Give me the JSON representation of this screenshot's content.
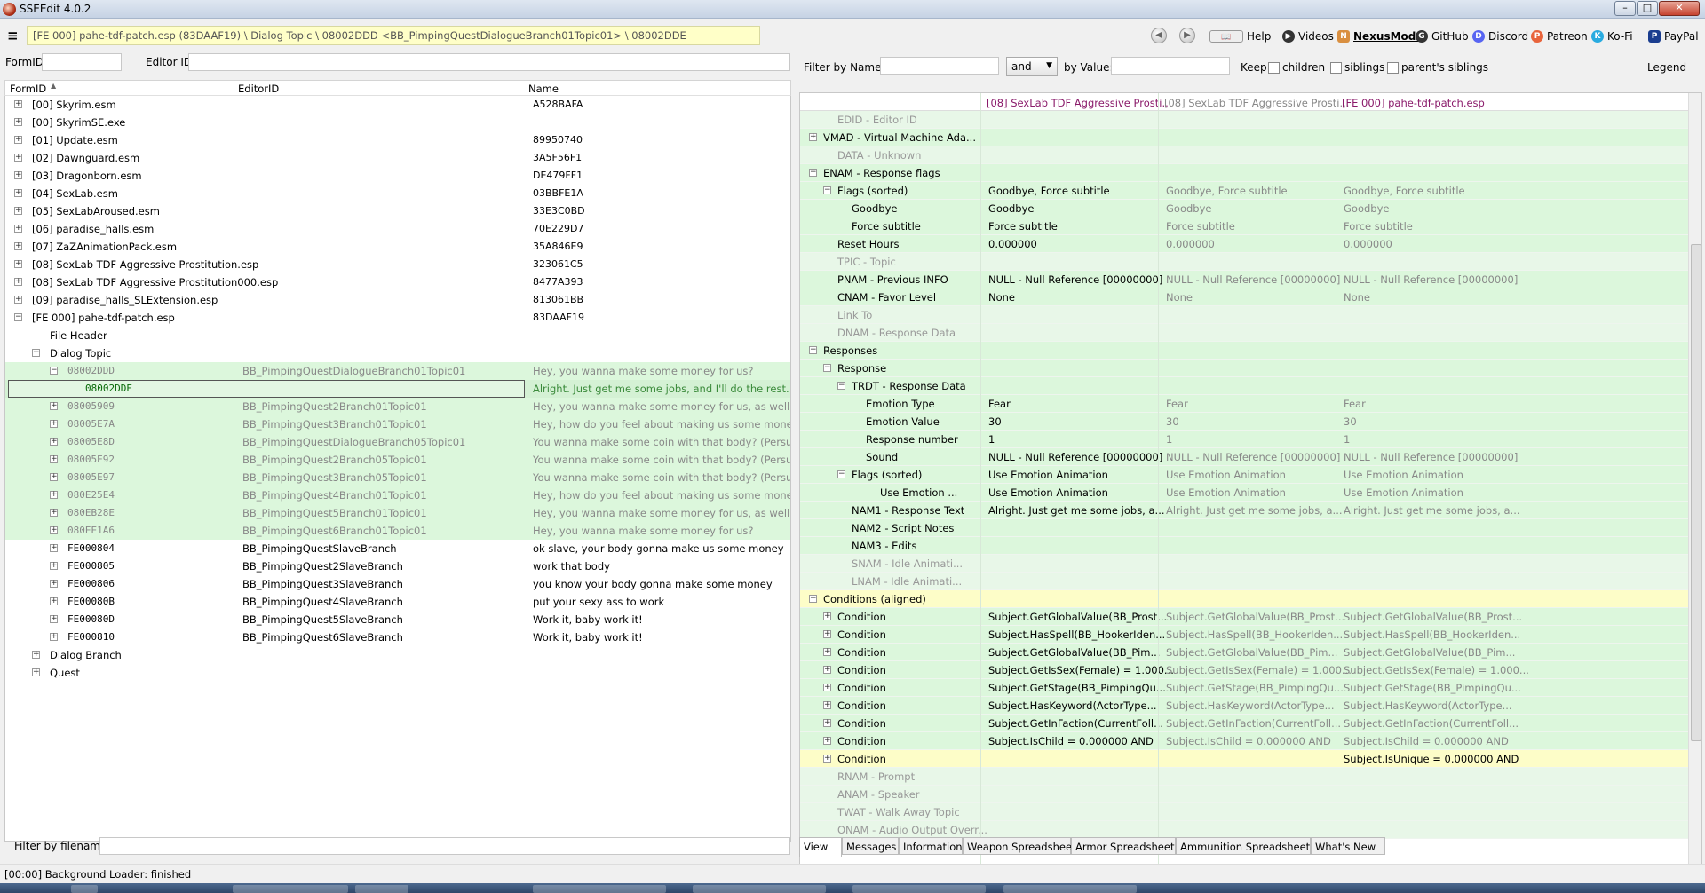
{
  "window": {
    "title": "SSEEdit 4.0.2",
    "min": "–",
    "max": "□",
    "close": "✕"
  },
  "toolbar": {
    "menu_icon": "≡",
    "path": "[FE 000] pahe-tdf-patch.esp (83DAAF19) \\ Dialog Topic \\ 08002DDD <BB_PimpingQuestDialogueBranch01Topic01> \\ 08002DDE",
    "links": [
      "Help",
      "Videos",
      "NexusMods",
      "GitHub",
      "Discord",
      "Patreon",
      "Ko-Fi",
      "PayPal"
    ]
  },
  "left": {
    "formid_label": "FormID",
    "editorid_label": "Editor ID",
    "columns": [
      "FormID",
      "EditorID",
      "Name"
    ],
    "tree": [
      {
        "indent": 0,
        "exp": "+",
        "id": "[00] Skyrim.esm",
        "editor": "",
        "name": "A528BAFA"
      },
      {
        "indent": 0,
        "exp": "+",
        "id": "[00] SkyrimSE.exe",
        "editor": "",
        "name": ""
      },
      {
        "indent": 0,
        "exp": "+",
        "id": "[01] Update.esm",
        "editor": "",
        "name": "89950740"
      },
      {
        "indent": 0,
        "exp": "+",
        "id": "[02] Dawnguard.esm",
        "editor": "",
        "name": "3A5F56F1"
      },
      {
        "indent": 0,
        "exp": "+",
        "id": "[03] Dragonborn.esm",
        "editor": "",
        "name": "DE479FF1"
      },
      {
        "indent": 0,
        "exp": "+",
        "id": "[04] SexLab.esm",
        "editor": "",
        "name": "03BBFE1A"
      },
      {
        "indent": 0,
        "exp": "+",
        "id": "[05] SexLabAroused.esm",
        "editor": "",
        "name": "33E3C0BD"
      },
      {
        "indent": 0,
        "exp": "+",
        "id": "[06] paradise_halls.esm",
        "editor": "",
        "name": "70E229D7"
      },
      {
        "indent": 0,
        "exp": "+",
        "id": "[07] ZaZAnimationPack.esm",
        "editor": "",
        "name": "35A846E9"
      },
      {
        "indent": 0,
        "exp": "+",
        "id": "[08] SexLab TDF Aggressive Prostitution.esp",
        "editor": "",
        "name": "323061C5"
      },
      {
        "indent": 0,
        "exp": "+",
        "id": "[08] SexLab TDF Aggressive Prostitution000.esp",
        "editor": "",
        "name": "8477A393"
      },
      {
        "indent": 0,
        "exp": "+",
        "id": "[09] paradise_halls_SLExtension.esp",
        "editor": "",
        "name": "813061BB"
      },
      {
        "indent": 0,
        "exp": "−",
        "id": "[FE 000] pahe-tdf-patch.esp",
        "editor": "",
        "name": "83DAAF19"
      },
      {
        "indent": 1,
        "exp": "",
        "id": "File Header",
        "editor": "",
        "name": ""
      },
      {
        "indent": 1,
        "exp": "−",
        "id": "Dialog Topic",
        "editor": "",
        "name": ""
      },
      {
        "indent": 2,
        "exp": "−",
        "id": "08002DDD",
        "editor": "BB_PimpingQuestDialogueBranch01Topic01",
        "name": "Hey, you wanna make some money for us?",
        "style": "green"
      },
      {
        "indent": 3,
        "exp": "",
        "id": "08002DDE",
        "editor": "",
        "name": "Alright. Just get me some jobs, and I'll do the rest.",
        "style": "sel"
      },
      {
        "indent": 2,
        "exp": "+",
        "id": "08005909",
        "editor": "BB_PimpingQuest2Branch01Topic01",
        "name": "Hey, you wanna make some money for us, as well?",
        "style": "green"
      },
      {
        "indent": 2,
        "exp": "+",
        "id": "08005E7A",
        "editor": "BB_PimpingQuest3Branch01Topic01",
        "name": "Hey, how do you feel about making us some money...",
        "style": "green"
      },
      {
        "indent": 2,
        "exp": "+",
        "id": "08005E8D",
        "editor": "BB_PimpingQuestDialogueBranch05Topic01",
        "name": "You wanna make some coin with that body? (Persua...",
        "style": "green"
      },
      {
        "indent": 2,
        "exp": "+",
        "id": "08005E92",
        "editor": "BB_PimpingQuest2Branch05Topic01",
        "name": "You wanna make some coin with that body? (Persua...",
        "style": "green"
      },
      {
        "indent": 2,
        "exp": "+",
        "id": "08005E97",
        "editor": "BB_PimpingQuest3Branch05Topic01",
        "name": "You wanna make some coin with that body? (Persua...",
        "style": "green"
      },
      {
        "indent": 2,
        "exp": "+",
        "id": "080E25E4",
        "editor": "BB_PimpingQuest4Branch01Topic01",
        "name": "Hey, how do you feel about making us some money...",
        "style": "green"
      },
      {
        "indent": 2,
        "exp": "+",
        "id": "080EB28E",
        "editor": "BB_PimpingQuest5Branch01Topic01",
        "name": "Hey, you wanna make some money for us, as well?",
        "style": "green"
      },
      {
        "indent": 2,
        "exp": "+",
        "id": "080EE1A6",
        "editor": "BB_PimpingQuest6Branch01Topic01",
        "name": "Hey, you wanna make some money for us?",
        "style": "green"
      },
      {
        "indent": 2,
        "exp": "+",
        "id": "FE000804",
        "editor": "BB_PimpingQuestSlaveBranch",
        "name": "ok slave, your body gonna make us some money"
      },
      {
        "indent": 2,
        "exp": "+",
        "id": "FE000805",
        "editor": "BB_PimpingQuest2SlaveBranch",
        "name": "work that body"
      },
      {
        "indent": 2,
        "exp": "+",
        "id": "FE000806",
        "editor": "BB_PimpingQuest3SlaveBranch",
        "name": "you know your body gonna make some money"
      },
      {
        "indent": 2,
        "exp": "+",
        "id": "FE00080B",
        "editor": "BB_PimpingQuest4SlaveBranch",
        "name": "put your sexy ass to work"
      },
      {
        "indent": 2,
        "exp": "+",
        "id": "FE00080D",
        "editor": "BB_PimpingQuest5SlaveBranch",
        "name": "Work it, baby work it!"
      },
      {
        "indent": 2,
        "exp": "+",
        "id": "FE000810",
        "editor": "BB_PimpingQuest6SlaveBranch",
        "name": "Work it, baby work it!"
      },
      {
        "indent": 1,
        "exp": "+",
        "id": "Dialog Branch",
        "editor": "",
        "name": ""
      },
      {
        "indent": 1,
        "exp": "+",
        "id": "Quest",
        "editor": "",
        "name": ""
      }
    ],
    "filter_label": "Filter by filename:"
  },
  "right": {
    "filter_name_label": "Filter by Name:",
    "and_option": "and",
    "by_value_label": "by Value:",
    "keep_label": "Keep",
    "children_label": "children",
    "siblings_label": "siblings",
    "parents_siblings_label": "parent's siblings",
    "legend_label": "Legend",
    "columns": [
      "[08] SexLab TDF Aggressive Prosti...",
      "[08] SexLab TDF Aggressive Prosti...",
      "[FE 000] pahe-tdf-patch.esp"
    ],
    "rows": [
      {
        "indent": 1,
        "exp": "",
        "k": "EDID - Editor ID",
        "v1": "",
        "v2": "",
        "v3": "",
        "style": "lg",
        "grey": true
      },
      {
        "indent": 0,
        "exp": "+",
        "k": "VMAD - Virtual Machine Ada...",
        "v1": "",
        "v2": "",
        "v3": "",
        "style": "g"
      },
      {
        "indent": 1,
        "exp": "",
        "k": "DATA - Unknown",
        "v1": "",
        "v2": "",
        "v3": "",
        "style": "lg",
        "grey": true
      },
      {
        "indent": 0,
        "exp": "−",
        "k": "ENAM - Response flags",
        "v1": "",
        "v2": "",
        "v3": "",
        "style": "g"
      },
      {
        "indent": 1,
        "exp": "−",
        "k": "Flags (sorted)",
        "v1": "Goodbye, Force subtitle",
        "v2": "Goodbye, Force subtitle",
        "v3": "Goodbye, Force subtitle",
        "style": "g"
      },
      {
        "indent": 2,
        "exp": "",
        "k": "Goodbye",
        "v1": "Goodbye",
        "v2": "Goodbye",
        "v3": "Goodbye",
        "style": "g"
      },
      {
        "indent": 2,
        "exp": "",
        "k": "Force subtitle",
        "v1": "Force subtitle",
        "v2": "Force subtitle",
        "v3": "Force subtitle",
        "style": "g"
      },
      {
        "indent": 1,
        "exp": "",
        "k": "Reset Hours",
        "v1": "0.000000",
        "v2": "0.000000",
        "v3": "0.000000",
        "style": "g"
      },
      {
        "indent": 1,
        "exp": "",
        "k": "TPIC - Topic",
        "v1": "",
        "v2": "",
        "v3": "",
        "style": "lg",
        "grey": true
      },
      {
        "indent": 1,
        "exp": "",
        "k": "PNAM - Previous INFO",
        "v1": "NULL - Null Reference [00000000]",
        "v2": "NULL - Null Reference [00000000]",
        "v3": "NULL - Null Reference [00000000]",
        "style": "g"
      },
      {
        "indent": 1,
        "exp": "",
        "k": "CNAM - Favor Level",
        "v1": "None",
        "v2": "None",
        "v3": "None",
        "style": "g"
      },
      {
        "indent": 1,
        "exp": "",
        "k": "Link To",
        "v1": "",
        "v2": "",
        "v3": "",
        "style": "lg",
        "grey": true
      },
      {
        "indent": 1,
        "exp": "",
        "k": "DNAM - Response Data",
        "v1": "",
        "v2": "",
        "v3": "",
        "style": "lg",
        "grey": true
      },
      {
        "indent": 0,
        "exp": "−",
        "k": "Responses",
        "v1": "",
        "v2": "",
        "v3": "",
        "style": "g"
      },
      {
        "indent": 1,
        "exp": "−",
        "k": "Response",
        "v1": "",
        "v2": "",
        "v3": "",
        "style": "g"
      },
      {
        "indent": 2,
        "exp": "−",
        "k": "TRDT - Response Data",
        "v1": "",
        "v2": "",
        "v3": "",
        "style": "g"
      },
      {
        "indent": 3,
        "exp": "",
        "k": "Emotion Type",
        "v1": "Fear",
        "v2": "Fear",
        "v3": "Fear",
        "style": "g"
      },
      {
        "indent": 3,
        "exp": "",
        "k": "Emotion Value",
        "v1": "30",
        "v2": "30",
        "v3": "30",
        "style": "g"
      },
      {
        "indent": 3,
        "exp": "",
        "k": "Response number",
        "v1": "1",
        "v2": "1",
        "v3": "1",
        "style": "g"
      },
      {
        "indent": 3,
        "exp": "",
        "k": "Sound",
        "v1": "NULL - Null Reference [00000000]",
        "v2": "NULL - Null Reference [00000000]",
        "v3": "NULL - Null Reference [00000000]",
        "style": "g"
      },
      {
        "indent": 2,
        "exp": "−",
        "k": "Flags (sorted)",
        "v1": "Use Emotion Animation",
        "v2": "Use Emotion Animation",
        "v3": "Use Emotion Animation",
        "style": "g"
      },
      {
        "indent": 4,
        "exp": "",
        "k": "Use Emotion ...",
        "v1": "Use Emotion Animation",
        "v2": "Use Emotion Animation",
        "v3": "Use Emotion Animation",
        "style": "g"
      },
      {
        "indent": 2,
        "exp": "",
        "k": "NAM1 - Response Text",
        "v1": "Alright. Just get me some jobs, a...",
        "v2": "Alright. Just get me some jobs, a...",
        "v3": "Alright. Just get me some jobs, a...",
        "style": "g"
      },
      {
        "indent": 2,
        "exp": "",
        "k": "NAM2 - Script Notes",
        "v1": "",
        "v2": "",
        "v3": "",
        "style": "g"
      },
      {
        "indent": 2,
        "exp": "",
        "k": "NAM3 - Edits",
        "v1": "",
        "v2": "",
        "v3": "",
        "style": "g"
      },
      {
        "indent": 2,
        "exp": "",
        "k": "SNAM - Idle Animati...",
        "v1": "",
        "v2": "",
        "v3": "",
        "style": "lg",
        "grey": true
      },
      {
        "indent": 2,
        "exp": "",
        "k": "LNAM - Idle Animati...",
        "v1": "",
        "v2": "",
        "v3": "",
        "style": "lg",
        "grey": true
      },
      {
        "indent": 0,
        "exp": "−",
        "k": "Conditions (aligned)",
        "v1": "",
        "v2": "",
        "v3": "",
        "style": "y"
      },
      {
        "indent": 1,
        "exp": "+",
        "k": "Condition",
        "v1": "Subject.GetGlobalValue(BB_Prost...",
        "v2": "Subject.GetGlobalValue(BB_Prost...",
        "v3": "Subject.GetGlobalValue(BB_Prost...",
        "style": "g"
      },
      {
        "indent": 1,
        "exp": "+",
        "k": "Condition",
        "v1": "Subject.HasSpell(BB_HookerIden...",
        "v2": "Subject.HasSpell(BB_HookerIden...",
        "v3": "Subject.HasSpell(BB_HookerIden...",
        "style": "g"
      },
      {
        "indent": 1,
        "exp": "+",
        "k": "Condition",
        "v1": "Subject.GetGlobalValue(BB_Pim...",
        "v2": "Subject.GetGlobalValue(BB_Pim...",
        "v3": "Subject.GetGlobalValue(BB_Pim...",
        "style": "g"
      },
      {
        "indent": 1,
        "exp": "+",
        "k": "Condition",
        "v1": "Subject.GetIsSex(Female) = 1.000...",
        "v2": "Subject.GetIsSex(Female) = 1.000...",
        "v3": "Subject.GetIsSex(Female) = 1.000...",
        "style": "g"
      },
      {
        "indent": 1,
        "exp": "+",
        "k": "Condition",
        "v1": "Subject.GetStage(BB_PimpingQu...",
        "v2": "Subject.GetStage(BB_PimpingQu...",
        "v3": "Subject.GetStage(BB_PimpingQu...",
        "style": "g"
      },
      {
        "indent": 1,
        "exp": "+",
        "k": "Condition",
        "v1": "Subject.HasKeyword(ActorType...",
        "v2": "Subject.HasKeyword(ActorType...",
        "v3": "Subject.HasKeyword(ActorType...",
        "style": "g"
      },
      {
        "indent": 1,
        "exp": "+",
        "k": "Condition",
        "v1": "Subject.GetInFaction(CurrentFoll...",
        "v2": "Subject.GetInFaction(CurrentFoll...",
        "v3": "Subject.GetInFaction(CurrentFoll...",
        "style": "g"
      },
      {
        "indent": 1,
        "exp": "+",
        "k": "Condition",
        "v1": "Subject.IsChild = 0.000000 AND",
        "v2": "Subject.IsChild = 0.000000 AND",
        "v3": "Subject.IsChild = 0.000000 AND",
        "style": "g"
      },
      {
        "indent": 1,
        "exp": "+",
        "k": "Condition",
        "v1": "",
        "v2": "",
        "v3": "Subject.IsUnique = 0.000000 AND",
        "style": "y"
      },
      {
        "indent": 1,
        "exp": "",
        "k": "RNAM - Prompt",
        "v1": "",
        "v2": "",
        "v3": "",
        "style": "lg",
        "grey": true
      },
      {
        "indent": 1,
        "exp": "",
        "k": "ANAM - Speaker",
        "v1": "",
        "v2": "",
        "v3": "",
        "style": "lg",
        "grey": true
      },
      {
        "indent": 1,
        "exp": "",
        "k": "TWAT - Walk Away Topic",
        "v1": "",
        "v2": "",
        "v3": "",
        "style": "lg",
        "grey": true
      },
      {
        "indent": 1,
        "exp": "",
        "k": "ONAM - Audio Output Overr...",
        "v1": "",
        "v2": "",
        "v3": "",
        "style": "lg",
        "grey": true
      }
    ],
    "tabs": [
      "View",
      "Messages",
      "Information",
      "Weapon Spreadsheet",
      "Armor Spreadsheet",
      "Ammunition Spreadsheet",
      "What's New"
    ]
  },
  "status": "[00:00] Background Loader: finished"
}
